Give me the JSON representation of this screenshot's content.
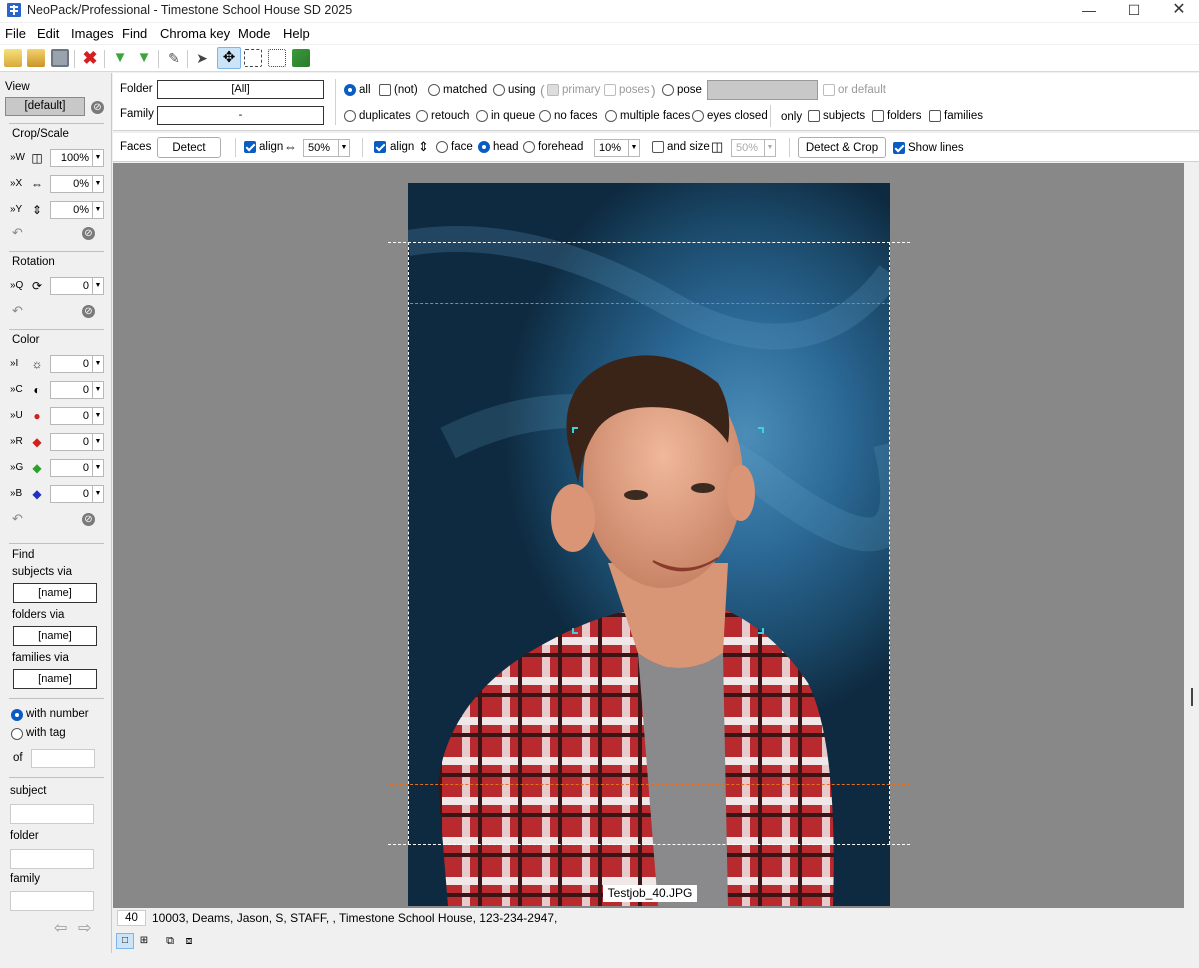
{
  "window": {
    "title": "NeoPack/Professional - Timestone School House SD 2025"
  },
  "menu": [
    "File",
    "Edit",
    "Images",
    "Find",
    "Chroma key",
    "Mode",
    "Help"
  ],
  "left": {
    "view_label": "View",
    "view_value": "[default]",
    "crop_label": "Crop/Scale",
    "crop_rows": [
      {
        "key": "»W",
        "value": "100%"
      },
      {
        "key": "»X",
        "value": "0%"
      },
      {
        "key": "»Y",
        "value": "0%"
      }
    ],
    "rotation_label": "Rotation",
    "rotation_rows": [
      {
        "key": "»Q",
        "value": "0"
      }
    ],
    "color_label": "Color",
    "color_rows": [
      {
        "key": "»I",
        "value": "0"
      },
      {
        "key": "»C",
        "value": "0"
      },
      {
        "key": "»U",
        "value": "0"
      },
      {
        "key": "»R",
        "value": "0"
      },
      {
        "key": "»G",
        "value": "0"
      },
      {
        "key": "»B",
        "value": "0"
      }
    ],
    "find_label": "Find",
    "subjects_via": "subjects via",
    "subjects_value": "[name]",
    "folders_via": "folders via",
    "folders_value": "[name]",
    "families_via": "families via",
    "families_value": "[name]",
    "with_number": "with number",
    "with_tag": "with tag",
    "of_label": "of",
    "subject_label": "subject",
    "folder_label": "folder",
    "family_label": "family"
  },
  "filter": {
    "folder_label": "Folder",
    "folder_value": "[All]",
    "family_label": "Family",
    "family_value": "-",
    "all": "all",
    "not": "(not)",
    "matched": "matched",
    "using": "using",
    "primary": "primary",
    "poses": "poses",
    "pose": "pose",
    "or_default": "or default",
    "duplicates": "duplicates",
    "retouch": "retouch",
    "in_queue": "in queue",
    "no_faces": "no faces",
    "multiple_faces": "multiple faces",
    "eyes_closed": "eyes closed",
    "only": "only",
    "subjects": "subjects",
    "folders": "folders",
    "families": "families"
  },
  "faces": {
    "label": "Faces",
    "detect": "Detect",
    "align1": "align",
    "align1_value": "50%",
    "align2": "align",
    "face": "face",
    "head": "head",
    "forehead": "forehead",
    "pct_value": "10%",
    "and_size": "and size",
    "size_value": "50%",
    "detect_crop": "Detect & Crop",
    "show_lines": "Show lines"
  },
  "image": {
    "filename": "Testjob_40.JPG"
  },
  "status": {
    "number": "40",
    "text": "10003, Deams, Jason, S, STAFF, , Timestone School House, 123-234-2947,"
  },
  "colors": {
    "accent": "#0a5cc2",
    "viewport": "#888888"
  }
}
